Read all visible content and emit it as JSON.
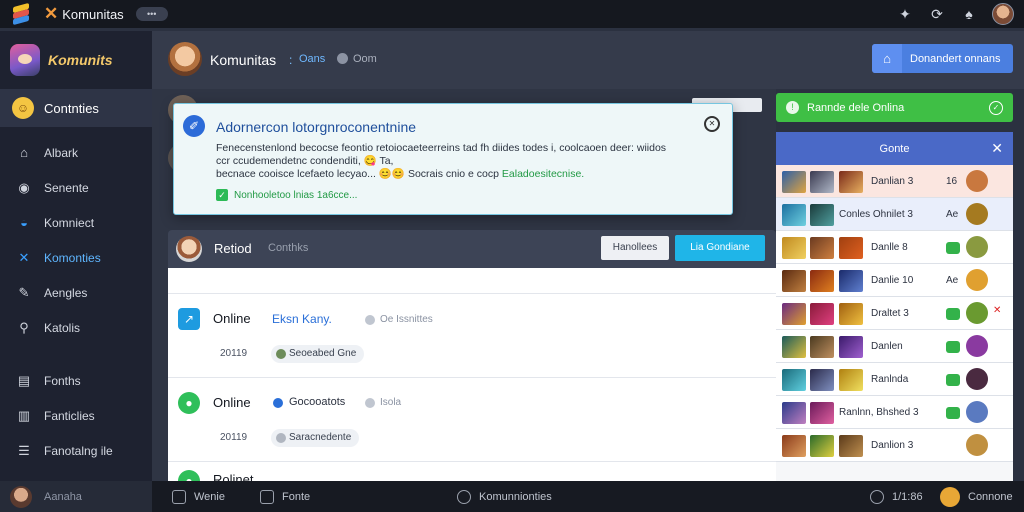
{
  "titlebar": {
    "title": "Komunitas",
    "pill": "•••",
    "icons": [
      "bell-icon",
      "refresh-icon",
      "settings-icon"
    ]
  },
  "sidebar": {
    "brand": "Komunits",
    "active": {
      "label": "Contnties"
    },
    "items": [
      {
        "label": "Albark",
        "icon": "home-icon"
      },
      {
        "label": "Senente",
        "icon": "record-icon"
      },
      {
        "label": "Komniect",
        "icon": "globe-icon"
      },
      {
        "label": "Komonties",
        "icon": "tools-icon"
      },
      {
        "label": "Aengles",
        "icon": "pen-icon"
      },
      {
        "label": "Katolis",
        "icon": "search-icon"
      }
    ],
    "bottom_items": [
      {
        "label": "Fonths",
        "icon": "doc-icon"
      },
      {
        "label": "Fanticlies",
        "icon": "chart-icon"
      },
      {
        "label": "Fanotalng ile",
        "icon": "list-icon"
      }
    ],
    "footer": "Aanaha"
  },
  "header": {
    "title": "Komunitas",
    "status": "Oans",
    "sub": "Oom",
    "button_label": "Donandert onnans"
  },
  "modal": {
    "title": "Adornercon lotorgnroconentnine",
    "body_lines": [
      "Fenecenstenlond becocse feontio retoiocaeteerreins tad fh diides todes i, coolcaoen deer: wiidos",
      "ccr ccudemendetnc condenditi, 😋 Ta,",
      "becnace cooisce lcefaeto lecyao..."
    ],
    "body_emoji": "😊😊",
    "body_tail": "Socrais cnio e cocp",
    "body_link": "Ealadoesitecnise.",
    "check_label": "Nonhooletoo lnias 1a6cce..."
  },
  "section": {
    "title": "Retiod",
    "subtitle": "Conthks",
    "button_secondary": "Hanollees",
    "button_primary": "Lia Gondiane"
  },
  "list": [
    {
      "status": "Online",
      "name": "Eksn Kany.",
      "meta": "Oe Issnittes",
      "date": "20119",
      "chip": "Seoeabed Gne"
    },
    {
      "status": "Online",
      "name": "Gocooatots",
      "meta": "Isola",
      "date": "20119",
      "chip": "Saracnedente"
    },
    {
      "status": "Rolinet",
      "name": "",
      "meta": "",
      "date": "",
      "chip": ""
    }
  ],
  "green_bar": {
    "label": "Rannde dele Onlina"
  },
  "panel": {
    "title": "Gonte",
    "rows": [
      {
        "label": "Danlian 3",
        "value": "16"
      },
      {
        "label": "Conles Ohnilet 3",
        "value": "Ae"
      },
      {
        "label": "Danlle 8",
        "value": ""
      },
      {
        "label": "Danlie 10",
        "value": "Ae"
      },
      {
        "label": "Draltet 3",
        "value": ""
      },
      {
        "label": "Danlen",
        "value": ""
      },
      {
        "label": "Ranlnda",
        "value": ""
      },
      {
        "label": "Ranlnn, Bhshed 3",
        "value": ""
      },
      {
        "label": "Danlion 3",
        "value": ""
      }
    ]
  },
  "bottombar": {
    "item1": "Wenie",
    "item2": "Fonte",
    "center": "Komunnionties",
    "time": "1/1:86",
    "user": "Connone"
  },
  "colors": {
    "accent": "#4b7fe0",
    "online": "#3fbf45",
    "primary_button": "#1fb5e8"
  }
}
